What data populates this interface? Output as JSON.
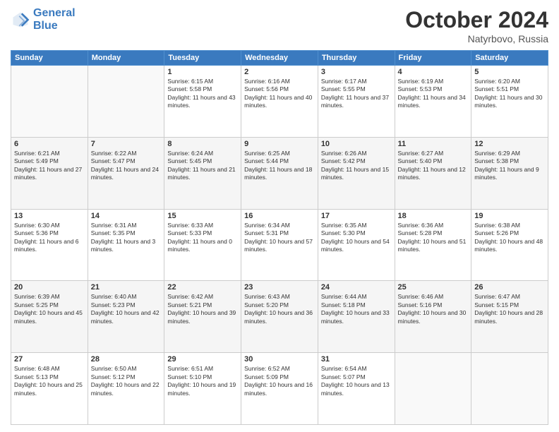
{
  "header": {
    "logo_line1": "General",
    "logo_line2": "Blue",
    "month": "October 2024",
    "location": "Natyrbovo, Russia"
  },
  "days_of_week": [
    "Sunday",
    "Monday",
    "Tuesday",
    "Wednesday",
    "Thursday",
    "Friday",
    "Saturday"
  ],
  "weeks": [
    [
      {
        "day": "",
        "text": ""
      },
      {
        "day": "",
        "text": ""
      },
      {
        "day": "1",
        "text": "Sunrise: 6:15 AM\nSunset: 5:58 PM\nDaylight: 11 hours and 43 minutes."
      },
      {
        "day": "2",
        "text": "Sunrise: 6:16 AM\nSunset: 5:56 PM\nDaylight: 11 hours and 40 minutes."
      },
      {
        "day": "3",
        "text": "Sunrise: 6:17 AM\nSunset: 5:55 PM\nDaylight: 11 hours and 37 minutes."
      },
      {
        "day": "4",
        "text": "Sunrise: 6:19 AM\nSunset: 5:53 PM\nDaylight: 11 hours and 34 minutes."
      },
      {
        "day": "5",
        "text": "Sunrise: 6:20 AM\nSunset: 5:51 PM\nDaylight: 11 hours and 30 minutes."
      }
    ],
    [
      {
        "day": "6",
        "text": "Sunrise: 6:21 AM\nSunset: 5:49 PM\nDaylight: 11 hours and 27 minutes."
      },
      {
        "day": "7",
        "text": "Sunrise: 6:22 AM\nSunset: 5:47 PM\nDaylight: 11 hours and 24 minutes."
      },
      {
        "day": "8",
        "text": "Sunrise: 6:24 AM\nSunset: 5:45 PM\nDaylight: 11 hours and 21 minutes."
      },
      {
        "day": "9",
        "text": "Sunrise: 6:25 AM\nSunset: 5:44 PM\nDaylight: 11 hours and 18 minutes."
      },
      {
        "day": "10",
        "text": "Sunrise: 6:26 AM\nSunset: 5:42 PM\nDaylight: 11 hours and 15 minutes."
      },
      {
        "day": "11",
        "text": "Sunrise: 6:27 AM\nSunset: 5:40 PM\nDaylight: 11 hours and 12 minutes."
      },
      {
        "day": "12",
        "text": "Sunrise: 6:29 AM\nSunset: 5:38 PM\nDaylight: 11 hours and 9 minutes."
      }
    ],
    [
      {
        "day": "13",
        "text": "Sunrise: 6:30 AM\nSunset: 5:36 PM\nDaylight: 11 hours and 6 minutes."
      },
      {
        "day": "14",
        "text": "Sunrise: 6:31 AM\nSunset: 5:35 PM\nDaylight: 11 hours and 3 minutes."
      },
      {
        "day": "15",
        "text": "Sunrise: 6:33 AM\nSunset: 5:33 PM\nDaylight: 11 hours and 0 minutes."
      },
      {
        "day": "16",
        "text": "Sunrise: 6:34 AM\nSunset: 5:31 PM\nDaylight: 10 hours and 57 minutes."
      },
      {
        "day": "17",
        "text": "Sunrise: 6:35 AM\nSunset: 5:30 PM\nDaylight: 10 hours and 54 minutes."
      },
      {
        "day": "18",
        "text": "Sunrise: 6:36 AM\nSunset: 5:28 PM\nDaylight: 10 hours and 51 minutes."
      },
      {
        "day": "19",
        "text": "Sunrise: 6:38 AM\nSunset: 5:26 PM\nDaylight: 10 hours and 48 minutes."
      }
    ],
    [
      {
        "day": "20",
        "text": "Sunrise: 6:39 AM\nSunset: 5:25 PM\nDaylight: 10 hours and 45 minutes."
      },
      {
        "day": "21",
        "text": "Sunrise: 6:40 AM\nSunset: 5:23 PM\nDaylight: 10 hours and 42 minutes."
      },
      {
        "day": "22",
        "text": "Sunrise: 6:42 AM\nSunset: 5:21 PM\nDaylight: 10 hours and 39 minutes."
      },
      {
        "day": "23",
        "text": "Sunrise: 6:43 AM\nSunset: 5:20 PM\nDaylight: 10 hours and 36 minutes."
      },
      {
        "day": "24",
        "text": "Sunrise: 6:44 AM\nSunset: 5:18 PM\nDaylight: 10 hours and 33 minutes."
      },
      {
        "day": "25",
        "text": "Sunrise: 6:46 AM\nSunset: 5:16 PM\nDaylight: 10 hours and 30 minutes."
      },
      {
        "day": "26",
        "text": "Sunrise: 6:47 AM\nSunset: 5:15 PM\nDaylight: 10 hours and 28 minutes."
      }
    ],
    [
      {
        "day": "27",
        "text": "Sunrise: 6:48 AM\nSunset: 5:13 PM\nDaylight: 10 hours and 25 minutes."
      },
      {
        "day": "28",
        "text": "Sunrise: 6:50 AM\nSunset: 5:12 PM\nDaylight: 10 hours and 22 minutes."
      },
      {
        "day": "29",
        "text": "Sunrise: 6:51 AM\nSunset: 5:10 PM\nDaylight: 10 hours and 19 minutes."
      },
      {
        "day": "30",
        "text": "Sunrise: 6:52 AM\nSunset: 5:09 PM\nDaylight: 10 hours and 16 minutes."
      },
      {
        "day": "31",
        "text": "Sunrise: 6:54 AM\nSunset: 5:07 PM\nDaylight: 10 hours and 13 minutes."
      },
      {
        "day": "",
        "text": ""
      },
      {
        "day": "",
        "text": ""
      }
    ]
  ]
}
